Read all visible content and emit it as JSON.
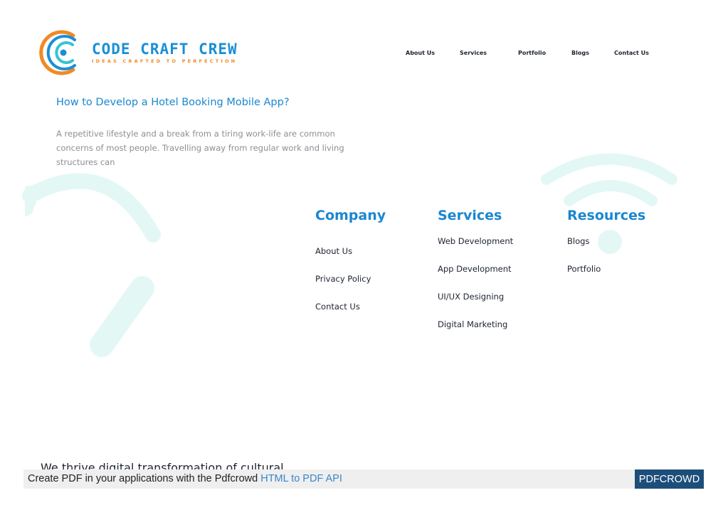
{
  "brand": {
    "name": "CODE CRAFT CREW",
    "tagline": "IDEAS CRAFTED TO PERFECTION"
  },
  "nav": {
    "items": [
      "About Us",
      "Services",
      "Portfolio",
      "Blogs",
      "Contact Us"
    ]
  },
  "post": {
    "title": "How to Develop a Hotel Booking Mobile App?",
    "excerpt": "A repetitive lifestyle and a break from a tiring work-life are common concerns of most people. Travelling away from regular work and living structures can"
  },
  "footer": {
    "company": {
      "title": "Company",
      "links": [
        "About Us",
        "Privacy Policy",
        "Contact Us"
      ]
    },
    "services": {
      "title": "Services",
      "links": [
        "Web Development",
        "App Development",
        "UI/UX Designing",
        "Digital Marketing"
      ]
    },
    "resources": {
      "title": "Resources",
      "links": [
        "Blogs",
        "Portfolio"
      ]
    }
  },
  "cut_off_text": "We thrive digital transformation of cultural",
  "pdf_banner": {
    "prefix": "Create PDF in your applications with the Pdfcrowd ",
    "link": "HTML to PDF API",
    "button": "PDFCROWD"
  },
  "colors": {
    "brand_blue": "#1a87d0",
    "brand_orange": "#f08a24",
    "decor_mint": "#e3f8f5",
    "pdf_button": "#1d4e7a"
  }
}
